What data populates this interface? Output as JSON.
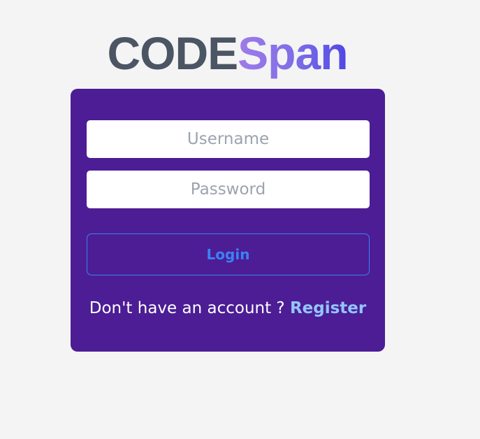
{
  "logo": {
    "part1": "CODE",
    "part2": "Span",
    "colors": {
      "code": "#4b5563",
      "span_gradient_start": "#a07be8",
      "span_gradient_end": "#4f46e5"
    }
  },
  "form": {
    "background": "#4c1d95",
    "username": {
      "placeholder": "Username",
      "value": ""
    },
    "password": {
      "placeholder": "Password",
      "value": ""
    },
    "login_label": "Login",
    "accent": "#3b82f6"
  },
  "register": {
    "prompt": "Don't have an account ?",
    "link_label": "Register",
    "link_color": "#93c5fd"
  }
}
